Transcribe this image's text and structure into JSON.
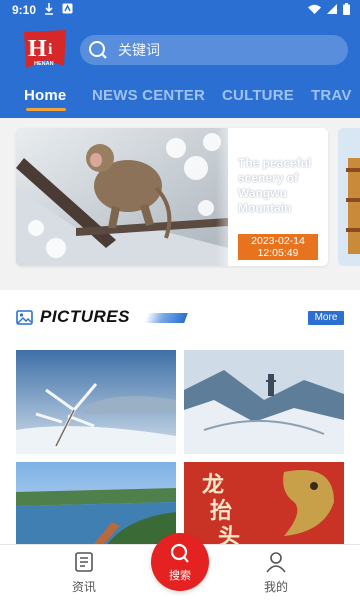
{
  "status_bar": {
    "time": "9:10"
  },
  "header": {
    "logo_text": "HENAN",
    "search": {
      "placeholder": "关键词"
    },
    "tabs": [
      {
        "label": "Home",
        "active": true
      },
      {
        "label": "NEWS CENTER",
        "active": false
      },
      {
        "label": "CULTURE",
        "active": false
      },
      {
        "label": "TRAV",
        "active": false
      }
    ]
  },
  "featured": {
    "title": "The peaceful scenery of Wangwu Mountain",
    "date": "2023-02-14 12:05:49"
  },
  "pictures": {
    "title": "PICTURES",
    "more_label": "More"
  },
  "bottom_nav": {
    "news_label": "资讯",
    "search_label": "搜索",
    "profile_label": "我的"
  },
  "colors": {
    "brand_blue": "#2a6fd1",
    "accent_orange": "#e8731f",
    "search_red": "#e52222"
  }
}
